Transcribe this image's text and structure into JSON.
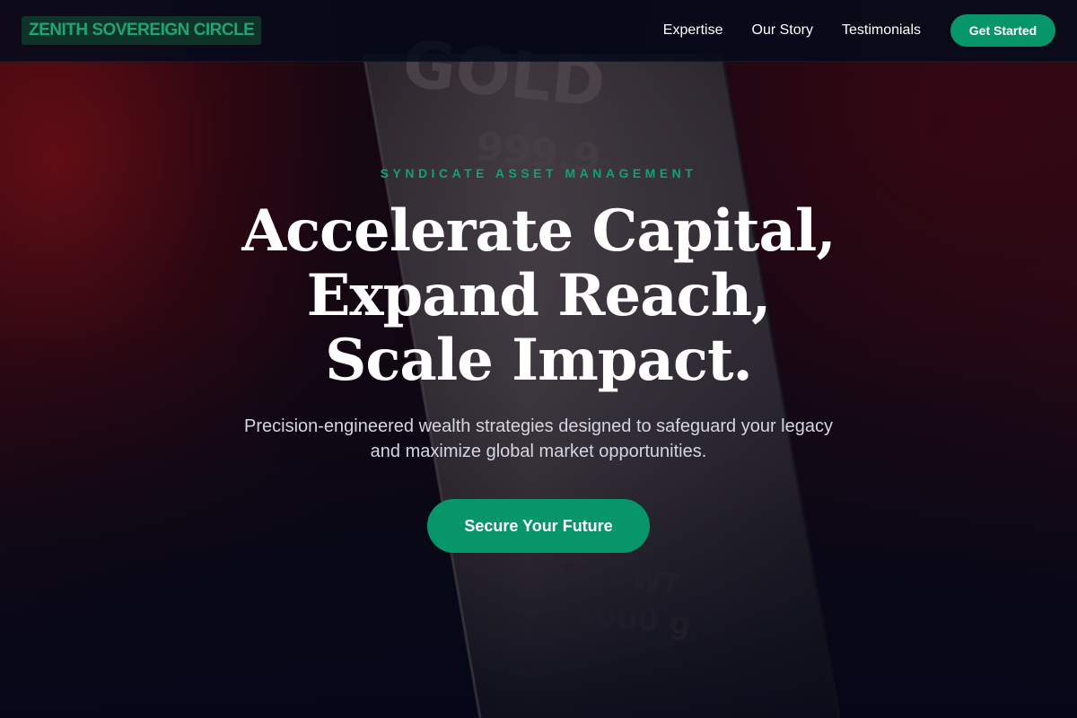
{
  "brand": {
    "logo_text": "ZENITH SOVEREIGN CIRCLE"
  },
  "nav": {
    "links": [
      "Expertise",
      "Our Story",
      "Testimonials"
    ],
    "cta_label": "Get Started"
  },
  "hero": {
    "eyebrow": "SYNDICATE ASSET MANAGEMENT",
    "headline_lines": [
      "Accelerate Capital,",
      "Expand Reach,",
      "Scale Impact."
    ],
    "subtitle": "Precision-engineered wealth strategies designed to safeguard your legacy and maximize global market opportunities.",
    "cta_label": "Secure Your Future",
    "background_image": {
      "subject": "gold-bar",
      "engraved_text": [
        "GOLD",
        "999.9",
        "NET WT",
        "1000 g"
      ]
    }
  },
  "colors": {
    "accent": "#07966a",
    "eyebrow": "#13a072",
    "logo_text": "#1fa574",
    "logo_bg": "#0f3328",
    "nav_bg": "#060a1a",
    "background": "#070a18"
  }
}
